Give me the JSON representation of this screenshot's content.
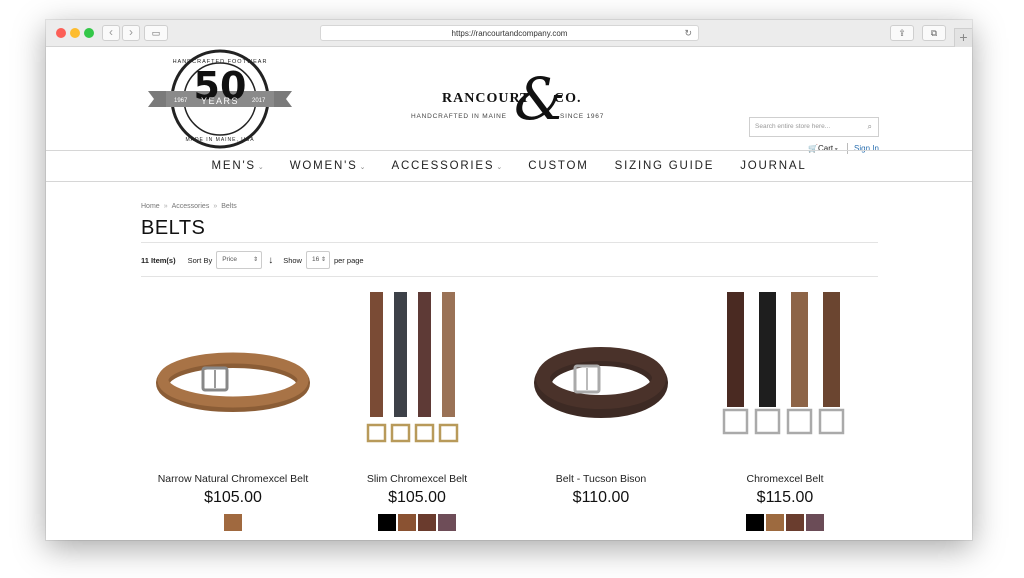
{
  "browser": {
    "url": "https://rancourtandcompany.com"
  },
  "header": {
    "badge": {
      "arc_top": "HANDCRAFTED FOOTWEAR",
      "number": "50",
      "years": "YEARS",
      "left_year": "1967",
      "right_year": "2017",
      "arc_bottom": "MADE IN MAINE, USA"
    },
    "brand": {
      "name": "RANCOURT",
      "amp": "&",
      "co": "CO.",
      "tagline_left": "HANDCRAFTED IN MAINE",
      "tagline_right": "SINCE 1967"
    },
    "search_placeholder": "Search entire store here...",
    "cart_label": "Cart",
    "signin_label": "Sign In"
  },
  "nav": {
    "items": [
      {
        "label": "MEN'S",
        "caret": true
      },
      {
        "label": "WOMEN'S",
        "caret": true
      },
      {
        "label": "ACCESSORIES",
        "caret": true
      },
      {
        "label": "CUSTOM",
        "caret": false
      },
      {
        "label": "SIZING GUIDE",
        "caret": false
      },
      {
        "label": "JOURNAL",
        "caret": false
      }
    ]
  },
  "breadcrumb": [
    "Home",
    "Accessories",
    "Belts"
  ],
  "page_title": "BELTS",
  "toolbar": {
    "item_count": "11 Item(s)",
    "sort_label": "Sort By",
    "sort_value": "Price",
    "show_label": "Show",
    "show_value": "16",
    "per_page_label": "per page"
  },
  "products": [
    {
      "name": "Narrow Natural Chromexcel Belt",
      "price": "$105.00",
      "swatches": [
        "#a0693f"
      ]
    },
    {
      "name": "Slim Chromexcel Belt",
      "price": "$105.00",
      "swatches": [
        "#000000",
        "#8a5232",
        "#6a3b2d",
        "#6e4d58"
      ]
    },
    {
      "name": "Belt - Tucson Bison",
      "price": "$110.00",
      "swatches": []
    },
    {
      "name": "Chromexcel Belt",
      "price": "$115.00",
      "swatches": [
        "#000000",
        "#9d6a3f",
        "#6a3d2e",
        "#6b4c57"
      ]
    }
  ],
  "colors": {
    "link": "#2a6fb0",
    "belt_brown": "#8a5a3a",
    "belt_black": "#2a2a2a",
    "belt_oxblood": "#5a3030"
  }
}
